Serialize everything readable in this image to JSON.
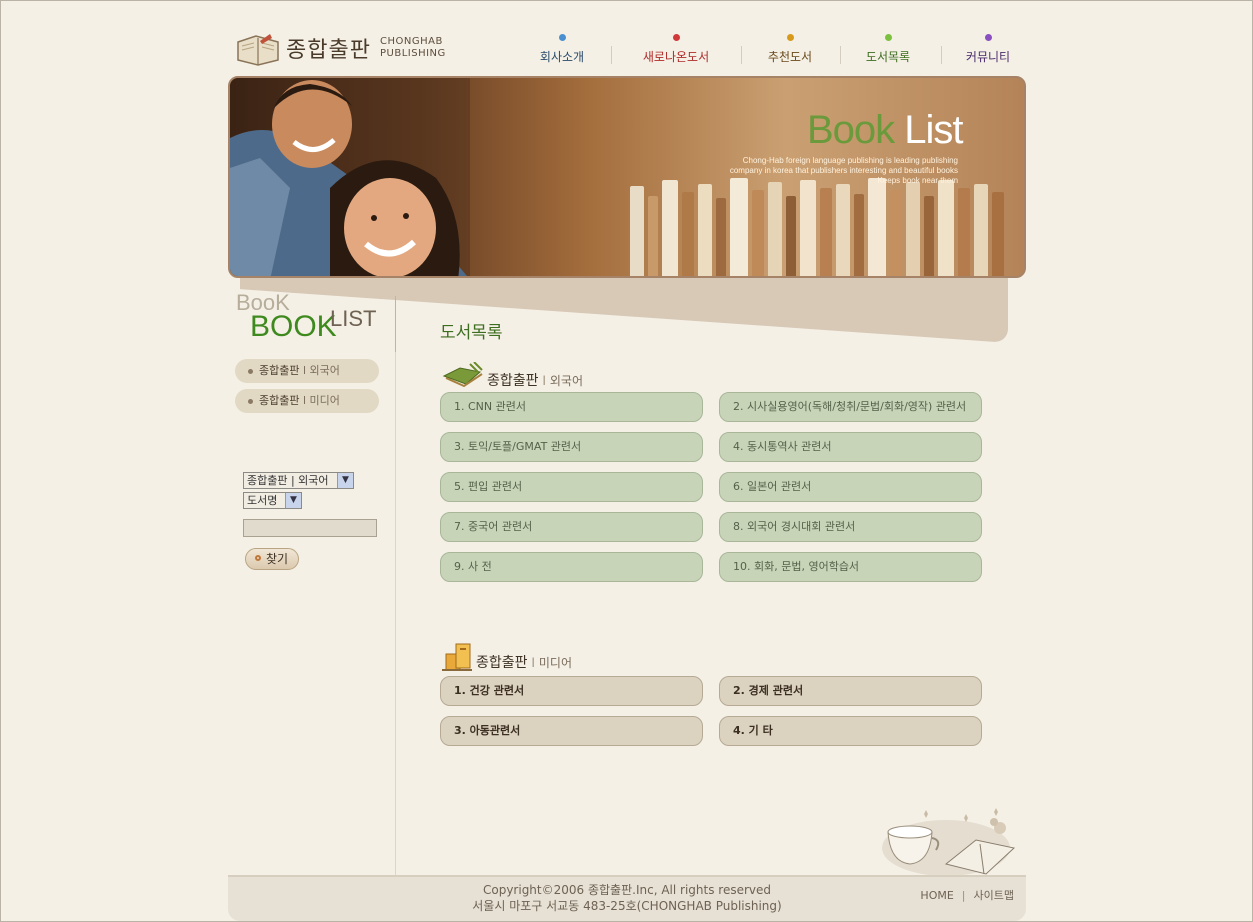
{
  "brand": {
    "name_ko": "종합출판",
    "name_en_line1": "CHONGHAB",
    "name_en_line2": "PUBLISHING"
  },
  "nav": [
    {
      "label": "회사소개",
      "color": "#4a90d0",
      "text_color": "#2a4a6a"
    },
    {
      "label": "새로나온도서",
      "color": "#d0383a",
      "text_color": "#b02a2a"
    },
    {
      "label": "추천도서",
      "color": "#d89a1a",
      "text_color": "#6a4a1a"
    },
    {
      "label": "도서목록",
      "color": "#7cc040",
      "text_color": "#3d6d1f"
    },
    {
      "label": "커뮤니티",
      "color": "#8a50c0",
      "text_color": "#4a2a6a"
    }
  ],
  "banner": {
    "title_word1": "Book",
    "title_word2": "List",
    "desc_line1": "Chong-Hab foreign language publishing is leading publishing",
    "desc_line2": "company in korea  that publishers interesting and beautiful books",
    "desc_line3": "Keeps book near them"
  },
  "sidebar": {
    "logo_small": "BooK",
    "logo_big": "BOOK",
    "logo_list": "LIST",
    "menu": [
      {
        "main": "종합출판",
        "sep": "l",
        "sub": "외국어"
      },
      {
        "main": "종합출판",
        "sep": "l",
        "sub": "미디어"
      }
    ],
    "search": {
      "category_select": "종합출판 | 외국어",
      "field_select": "도서명",
      "input_value": "",
      "button_label": "찾기"
    }
  },
  "main": {
    "page_title": "도서목록",
    "sections": [
      {
        "title": "종합출판",
        "sep": "l",
        "sub": "외국어",
        "items": [
          "1. CNN 관련서",
          "2. 시사실용영어(독해/청취/문법/회화/영작) 관련서",
          "3. 토익/토플/GMAT 관련서",
          "4. 동시통역사 관련서",
          "5. 편입 관련서",
          "6. 일본어 관련서",
          "7. 중국어 관련서",
          "8. 외국어 경시대회 관련서",
          "9. 사 전",
          "10. 회화, 문법, 영어학습서"
        ]
      },
      {
        "title": "종합출판",
        "sep": "l",
        "sub": "미디어",
        "items": [
          "1. 건강 관련서",
          "2. 경제 관련서",
          "3. 아동관련서",
          "4. 기 타"
        ]
      }
    ]
  },
  "footer": {
    "copyright": "Copyright©2006 종합출판.Inc, All rights reserved",
    "address": "서울시 마포구 서교동 483-25호(CHONGHAB Publishing)",
    "home": "HOME",
    "sep": "|",
    "sitemap": "사이트맵"
  }
}
